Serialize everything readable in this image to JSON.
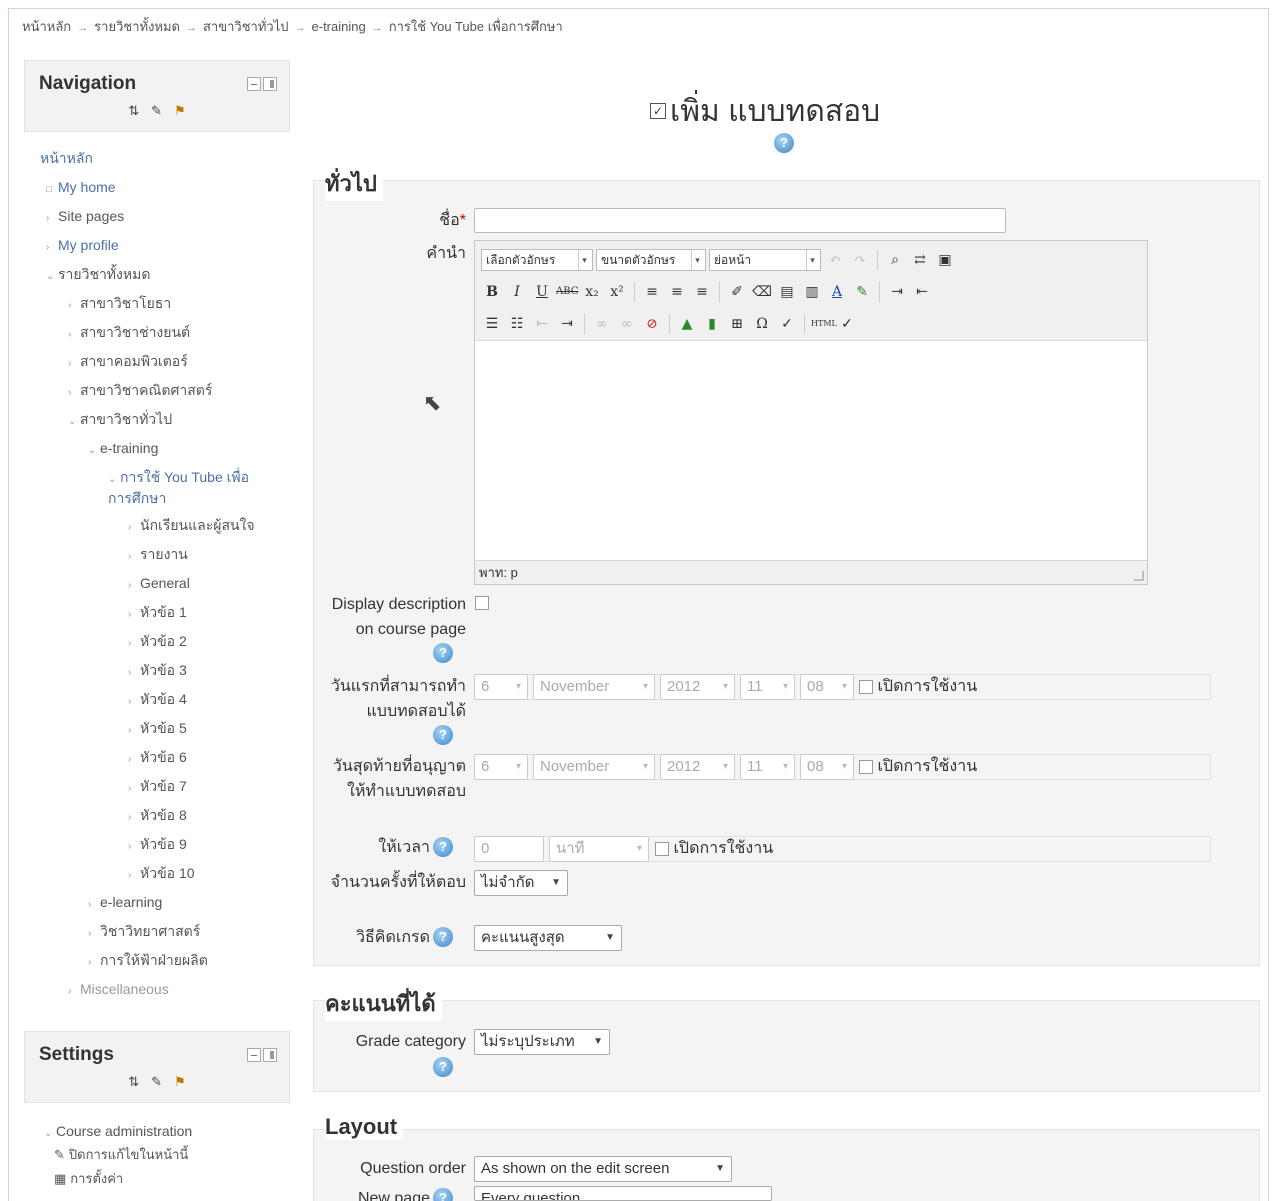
{
  "breadcrumb": [
    "หน้าหลัก",
    "รายวิชาทั้งหมด",
    "สาขาวิชาทั่วไป",
    "e-training",
    "การใช้ You Tube เพื่อการศึกษา"
  ],
  "navigation": {
    "title": "Navigation",
    "items": [
      {
        "label": "หน้าหลัก"
      },
      {
        "label": "My home"
      },
      {
        "label": "Site pages"
      },
      {
        "label": "My profile"
      },
      {
        "label": "รายวิชาทั้งหมด"
      },
      {
        "label": "สาขาวิชาโยธา"
      },
      {
        "label": "สาขาวิชาช่างยนต์"
      },
      {
        "label": "สาขาคอมพิวเตอร์"
      },
      {
        "label": "สาขาวิชาคณิตศาสตร์"
      },
      {
        "label": "สาขาวิชาทั่วไป"
      },
      {
        "label": "e-training"
      },
      {
        "label": "การใช้ You Tube เพื่อการศึกษา"
      },
      {
        "label": "นักเรียนและผู้สนใจ"
      },
      {
        "label": "รายงาน"
      },
      {
        "label": "General"
      },
      {
        "label": "หัวข้อ 1"
      },
      {
        "label": "หัวข้อ 2"
      },
      {
        "label": "หัวข้อ 3"
      },
      {
        "label": "หัวข้อ 4"
      },
      {
        "label": "หัวข้อ 5"
      },
      {
        "label": "หัวข้อ 6"
      },
      {
        "label": "หัวข้อ 7"
      },
      {
        "label": "หัวข้อ 8"
      },
      {
        "label": "หัวข้อ 9"
      },
      {
        "label": "หัวข้อ 10"
      },
      {
        "label": "e-learning"
      },
      {
        "label": "วิชาวิทยาศาสตร์"
      },
      {
        "label": "การให้ฟ้าฝ่ายผลิต"
      },
      {
        "label": "Miscellaneous"
      }
    ]
  },
  "settings": {
    "title": "Settings",
    "items": [
      {
        "label": "Course administration"
      },
      {
        "label": "ปิดการแก้ไขในหน้านี้"
      },
      {
        "label": "การตั้งค่า"
      }
    ]
  },
  "page": {
    "title": "เพิ่ม แบบทดสอบ"
  },
  "general": {
    "legend": "ทั่วไป",
    "name_label": "ชื่อ",
    "name_value": "",
    "desc_label": "คำนำ",
    "editor": {
      "font_family": "เลือกตัวอักษร",
      "font_size": "ขนาดตัวอักษร",
      "paragraph": "ย่อหน้า",
      "path": "พาท: p"
    },
    "display_desc_label": "Display description on course page",
    "open_label": "วันแรกที่สามารถทำแบบทดสอบได้",
    "close_label": "วันสุดท้ายที่อนุญาตให้ทำแบบทดสอบ",
    "date": {
      "day": "6",
      "month": "November",
      "year": "2012",
      "hour": "11",
      "minute": "08"
    },
    "enable_text": "เปิดการใช้งาน",
    "time_limit_label": "ให้เวลา",
    "time_limit_value": "0",
    "time_unit": "นาที",
    "attempts_label": "จำนวนครั้งที่ให้ตอบ",
    "attempts_value": "ไม่จำกัด",
    "grading_label": "วิธีคิดเกรด",
    "grading_value": "คะแนนสูงสุด"
  },
  "grade": {
    "legend": "คะแนนที่ได้",
    "category_label": "Grade category",
    "category_value": "ไม่ระบุประเภท"
  },
  "layout": {
    "legend": "Layout",
    "order_label": "Question order",
    "order_value": "As shown on the edit screen",
    "newpage_label": "New page",
    "newpage_value": "Every question"
  }
}
